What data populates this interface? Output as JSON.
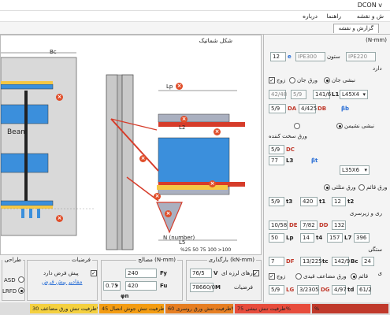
{
  "window": {
    "title": "DCON v"
  },
  "menu": {
    "items": [
      "ش و نقشه",
      "راهنما",
      "درباره"
    ]
  },
  "tabs": {
    "active": "گزارش و نقشه"
  },
  "canvas": {
    "title": "شکل شماتیک",
    "labels": {
      "bc": "Bc",
      "beam": "Beam",
      "lp": "Lp",
      "l5": "L5",
      "l2": "L2",
      "n": "N (number)",
      "legend": "%25  50  75  100  >100"
    }
  },
  "right": {
    "header": "(N-mm)",
    "section_row": {
      "value": "12",
      "e_label": "e",
      "column_section": "IPE300",
      "column_label": "ستون",
      "beam_section": "IPE220"
    },
    "plate_row": {
      "pair_label": "زوج",
      "web_plate": "ورق جان",
      "flange_plate": "نبشی جان",
      "has": "دارد"
    },
    "row3": {
      "a": "42/48",
      "b": "5/9",
      "c": "141/6",
      "angle": "L45X4",
      "l1": "L1"
    },
    "row4": {
      "a": "5/9",
      "db_val": "4/425",
      "db": "DB",
      "da": "DA",
      "bb": "βb"
    },
    "stiff_row": {
      "a": "نبشی نشیمن",
      "b": "ورق سخت کننده"
    },
    "dc_block": {
      "dc_val": "5/9",
      "dc": "DC",
      "l3_val": "77",
      "l3": "L3",
      "bt": "βt",
      "angle": "L35X6"
    },
    "tri_row": {
      "label": "ورق مثلثی",
      "b": "ورق قائم"
    },
    "t_row": {
      "t3_val": "5/9",
      "t3": "t3",
      "t1_val": "420",
      "t1": "t1",
      "t2_val": "12",
      "t2": "t2"
    },
    "sec2": {
      "title": "ری و زیرسری"
    },
    "de_row": {
      "de_val": "10/58",
      "de": "DE",
      "dd_val": "7/82",
      "dd": "DD",
      "v": "132"
    },
    "lp_row": {
      "lp_val": "50",
      "lp": "Lp",
      "t4_val": "14",
      "t4": "t4",
      "l7_val": "157",
      "l7": "L7",
      "v": "396"
    },
    "sec3": {
      "title": "ستگی"
    },
    "df_row": {
      "df_val": "7",
      "df": "DF",
      "tc_val": "13/225",
      "tc": "tc",
      "v": "142/9",
      "bc": "Bc",
      "v2": "24"
    },
    "sec4": {
      "title": "ی"
    },
    "pair_row": {
      "pair": "زوج",
      "b": "ورق مضاعف قیدی",
      "c": "قائم"
    },
    "lg_row": {
      "lg_val": "5/9",
      "lg": "LG",
      "v": "3/2305",
      "dg": "DG",
      "v2": "4/97",
      "td": "td",
      "v3": "61/2"
    }
  },
  "bottom": {
    "design": {
      "title": "طراحی",
      "asd": "ASD",
      "lrfd": "LRFD"
    },
    "assumptions": {
      "title": "فرضیات",
      "pre": "پیش فرض دارد",
      "link": "مقادیر پیش فرض"
    },
    "materials": {
      "title": "مصالح (N-mm)",
      "fy_val": "240",
      "fy": "Fy",
      "fu_val": "420",
      "fu": "Fu",
      "phi_val": "0.75",
      "phi": "φn"
    },
    "loads": {
      "title": "بارگذاری (kN-mm)",
      "seismic": "بارهای لرزه ای",
      "v_val": "76/5",
      "v": "V",
      "m_val": "78660/0",
      "m": "M",
      "assume": "فرضیات"
    }
  },
  "status": {
    "segments": [
      "ظرفیت تنش ورق مضاعف 30%",
      "ظرفیت تنش جوش اتصال 45%",
      "ظرفیت تنش ورق روسری 60%",
      "ظرفیت تنش نبشی 75%",
      "%"
    ],
    "colors": [
      "#f4d03f",
      "#f39c12",
      "#e67e22",
      "#e74c3c",
      "#c0392b"
    ]
  },
  "colors": {
    "beam": "#1e90ff",
    "plate_red": "#d63c2a",
    "plate_yellow": "#f6c744",
    "plate_grey": "#aab0c0"
  }
}
